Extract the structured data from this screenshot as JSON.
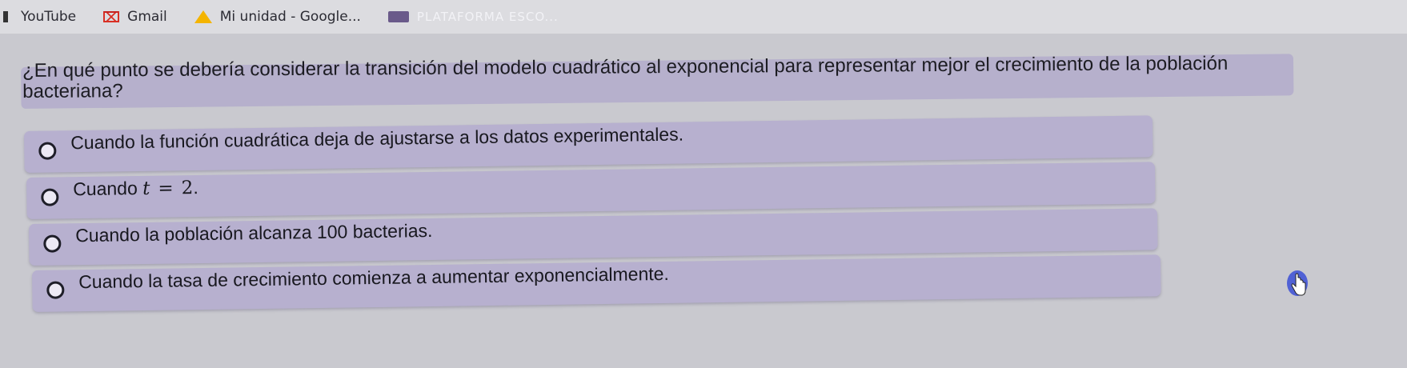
{
  "bookmarks": [
    {
      "label": "YouTube",
      "icon": "dot-icon"
    },
    {
      "label": "Gmail",
      "icon": "gmail-icon"
    },
    {
      "label": "Mi unidad - Google...",
      "icon": "drive-icon"
    },
    {
      "label": "PLATAFORMA ESCO...",
      "icon": "plataforma-icon"
    }
  ],
  "question": {
    "text": "¿En qué punto se debería considerar la transición del modelo cuadrático al exponencial para representar mejor el crecimiento de la población bacteriana?"
  },
  "options": [
    {
      "label": "Cuando la función cuadrática deja de ajustarse a los datos experimentales."
    },
    {
      "label_prefix": "Cuando",
      "math_var": "t",
      "math_eq": "=",
      "math_val": "2",
      "math_suffix": "."
    },
    {
      "label": "Cuando la población alcanza 100 bacterias."
    },
    {
      "label": "Cuando la tasa de crecimiento comienza a aumentar exponencialmente."
    }
  ],
  "colors": {
    "option_bg": "#b7b0cf",
    "page_bg": "#c9c9cf",
    "cursor": "#3b4fd6"
  }
}
